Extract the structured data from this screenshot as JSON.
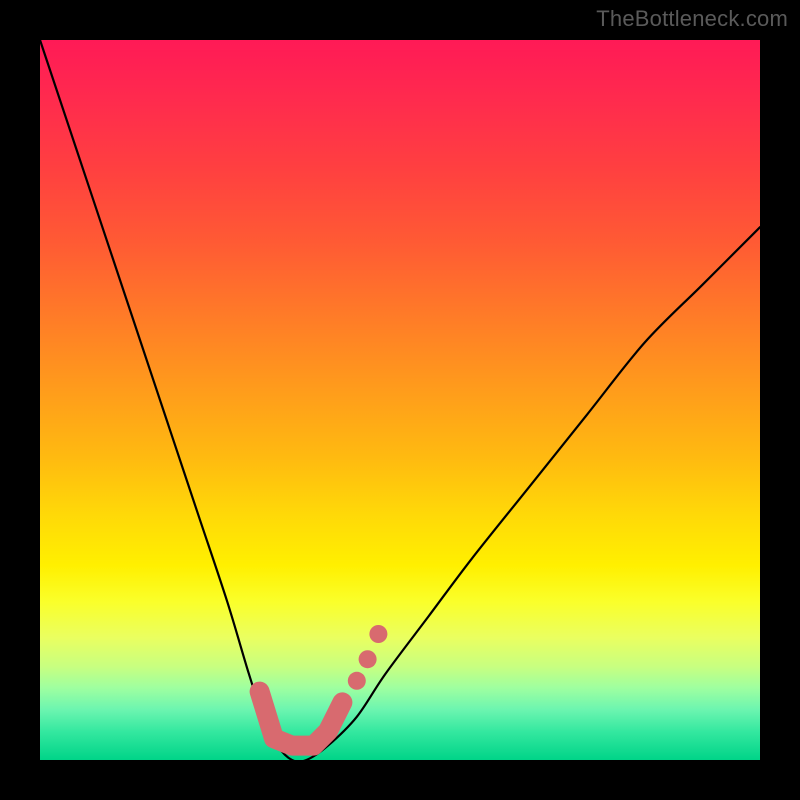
{
  "watermark": "TheBottleneck.com",
  "chart_data": {
    "type": "line",
    "title": "",
    "xlabel": "",
    "ylabel": "",
    "xlim": [
      0,
      100
    ],
    "ylim": [
      0,
      100
    ],
    "grid": false,
    "legend": false,
    "background_gradient": {
      "top": "#ff1a56",
      "middle": "#fff000",
      "bottom": "#00d488"
    },
    "series": [
      {
        "name": "bottleneck-curve",
        "color": "#000000",
        "x": [
          0,
          5,
          10,
          14,
          18,
          22,
          26,
          29,
          31,
          33,
          35,
          37,
          40,
          44,
          48,
          54,
          60,
          68,
          76,
          84,
          92,
          100
        ],
        "values": [
          100,
          85,
          70,
          58,
          46,
          34,
          22,
          12,
          6,
          2,
          0,
          0,
          2,
          6,
          12,
          20,
          28,
          38,
          48,
          58,
          66,
          74
        ]
      }
    ],
    "highlight": {
      "name": "optimal-range",
      "color": "#d86a6f",
      "stroke_points": [
        {
          "x": 30.5,
          "y": 9.5
        },
        {
          "x": 32.5,
          "y": 3.0
        },
        {
          "x": 35.0,
          "y": 2.0
        },
        {
          "x": 38.0,
          "y": 2.0
        },
        {
          "x": 40.0,
          "y": 4.0
        },
        {
          "x": 42.0,
          "y": 8.0
        }
      ],
      "dots": [
        {
          "x": 44.0,
          "y": 11.0
        },
        {
          "x": 45.5,
          "y": 14.0
        },
        {
          "x": 47.0,
          "y": 17.5
        }
      ]
    }
  }
}
